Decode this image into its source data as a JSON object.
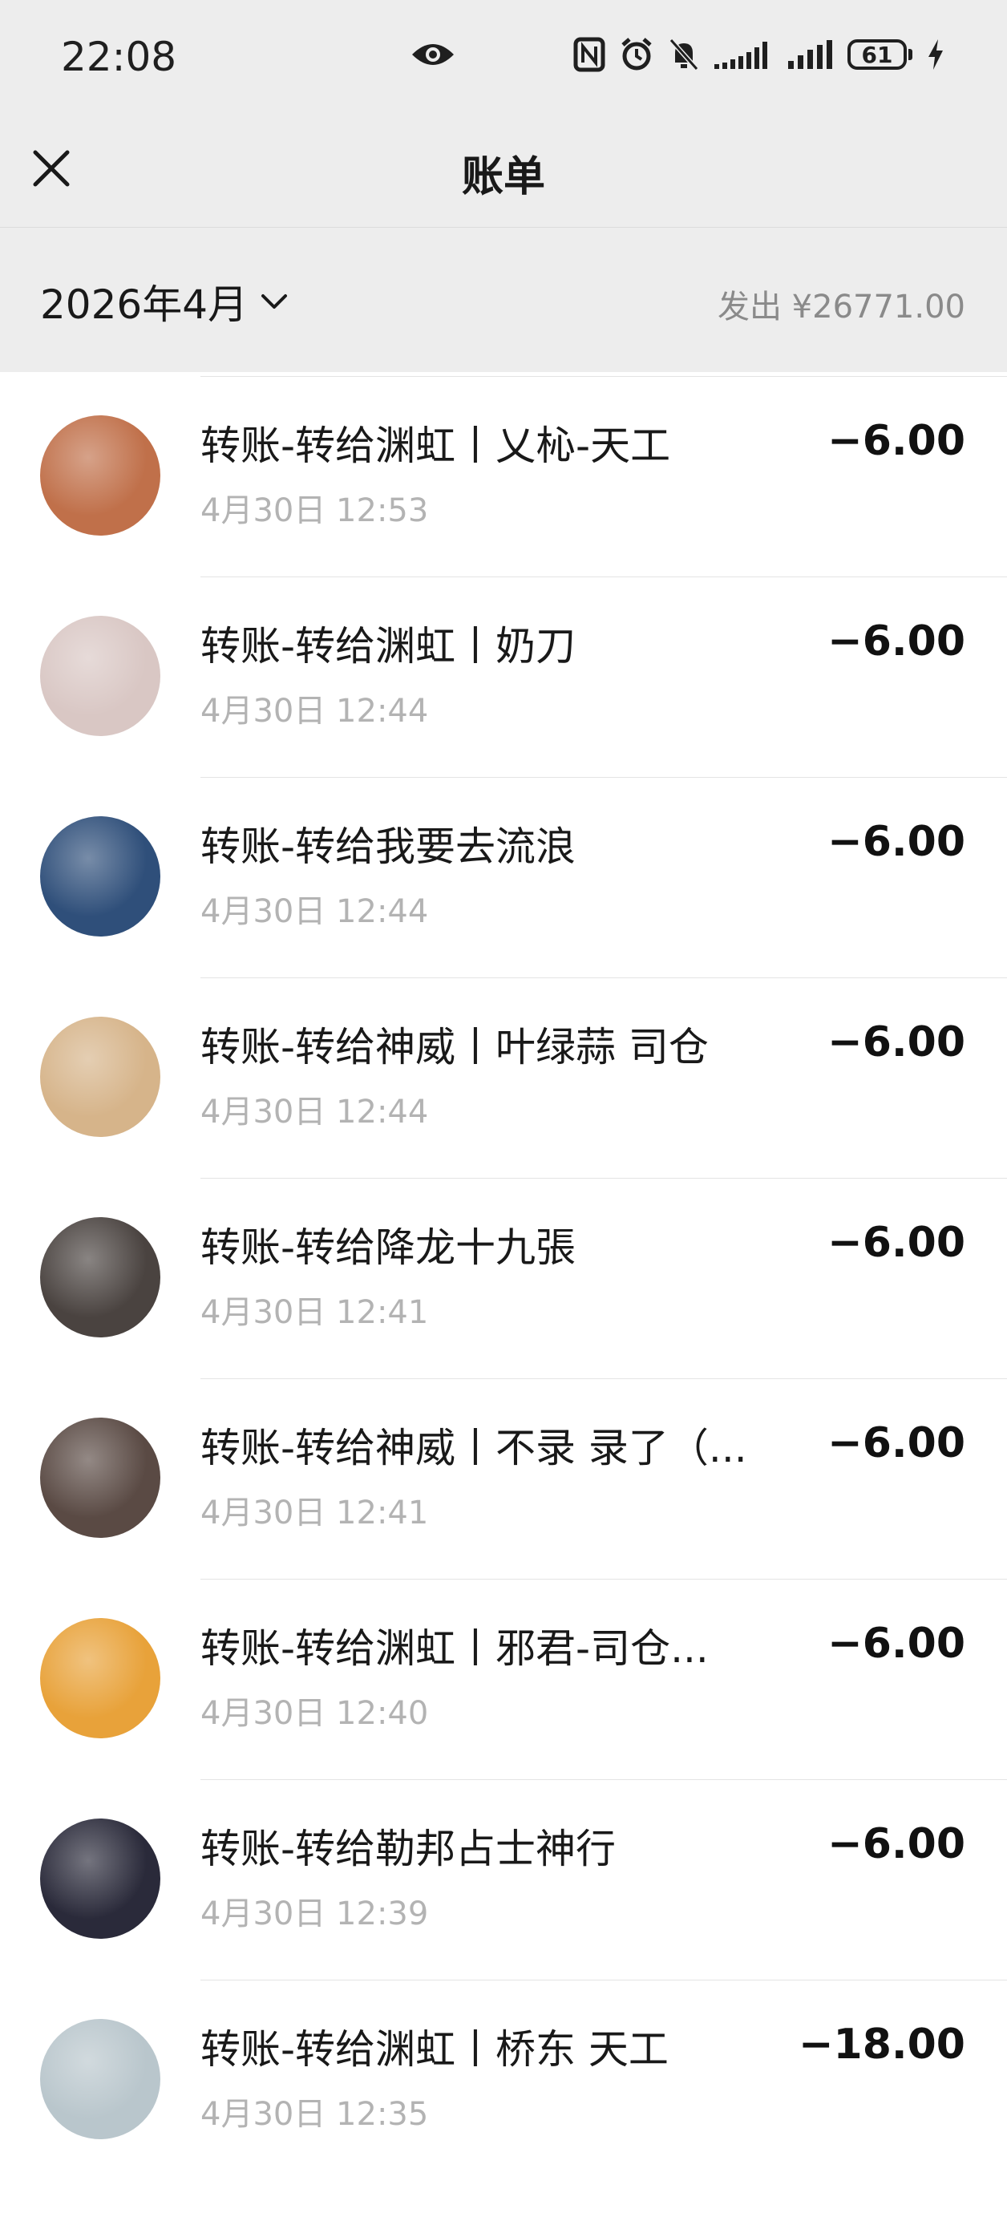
{
  "status_bar": {
    "time": "22:08",
    "battery": "61"
  },
  "header": {
    "title": "账单"
  },
  "filter": {
    "month": "2026年4月",
    "summary": "发出 ¥26771.00"
  },
  "transactions": [
    {
      "title": "转账-转给渊虹丨乂杺-天工",
      "time": "4月30日 12:53",
      "amount": "−6.00",
      "avatar_color": "#c0704a"
    },
    {
      "title": "转账-转给渊虹丨奶刀",
      "time": "4月30日 12:44",
      "amount": "−6.00",
      "avatar_color": "#d9c7c4"
    },
    {
      "title": "转账-转给我要去流浪",
      "time": "4月30日 12:44",
      "amount": "−6.00",
      "avatar_color": "#2f4f7a"
    },
    {
      "title": "转账-转给神威丨叶绿蒜 司仓",
      "time": "4月30日 12:44",
      "amount": "−6.00",
      "avatar_color": "#d6b48a"
    },
    {
      "title": "转账-转给降龙十九張",
      "time": "4月30日 12:41",
      "amount": "−6.00",
      "avatar_color": "#4a4340"
    },
    {
      "title": "转账-转给神威丨不录 录了（...",
      "time": "4月30日 12:41",
      "amount": "−6.00",
      "avatar_color": "#5a4a44"
    },
    {
      "title": "转账-转给渊虹丨邪君-司仓...",
      "time": "4月30日 12:40",
      "amount": "−6.00",
      "avatar_color": "#e8a23a"
    },
    {
      "title": "转账-转给勒邦占士神行",
      "time": "4月30日 12:39",
      "amount": "−6.00",
      "avatar_color": "#2a2a3a"
    },
    {
      "title": "转账-转给渊虹丨桥东 天工",
      "time": "4月30日 12:35",
      "amount": "−18.00",
      "avatar_color": "#b9c6cc"
    }
  ]
}
